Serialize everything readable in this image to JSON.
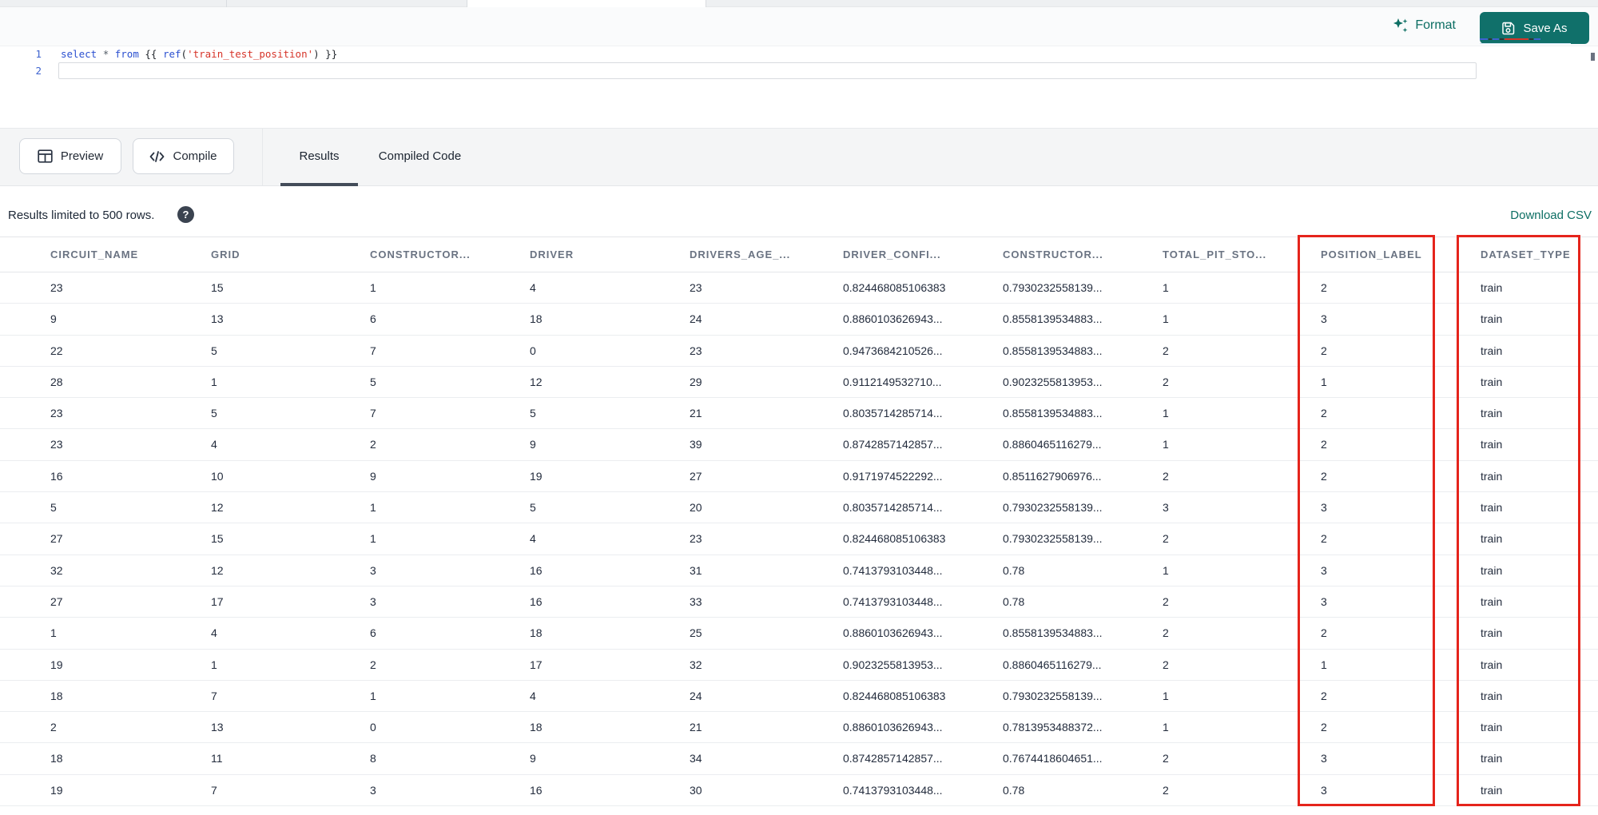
{
  "header": {
    "format_label": "Format",
    "save_as_label": "Save As"
  },
  "code_editor": {
    "lines": [
      {
        "number": "1",
        "tokens": [
          {
            "text": "select",
            "type": "kw"
          },
          {
            "text": " ",
            "type": "pl"
          },
          {
            "text": "*",
            "type": "op"
          },
          {
            "text": " ",
            "type": "pl"
          },
          {
            "text": "from",
            "type": "kw"
          },
          {
            "text": " {{ ",
            "type": "pl"
          },
          {
            "text": "ref",
            "type": "fn"
          },
          {
            "text": "(",
            "type": "pl"
          },
          {
            "text": "'train_test_position'",
            "type": "str"
          },
          {
            "text": ")",
            "type": "pl"
          },
          {
            "text": " }}",
            "type": "pl"
          }
        ]
      },
      {
        "number": "2",
        "tokens": []
      }
    ]
  },
  "toolbar": {
    "preview_label": "Preview",
    "compile_label": "Compile",
    "tabs": [
      {
        "label": "Results",
        "active": true
      },
      {
        "label": "Compiled Code",
        "active": false
      }
    ]
  },
  "results_bar": {
    "limit_text": "Results limited to 500 rows.",
    "help_glyph": "?",
    "download_label": "Download CSV"
  },
  "table": {
    "columns": [
      "CIRCUIT_NAME",
      "GRID",
      "CONSTRUCTOR...",
      "DRIVER",
      "DRIVERS_AGE_...",
      "DRIVER_CONFI...",
      "CONSTRUCTOR...",
      "TOTAL_PIT_STO...",
      "POSITION_LABEL",
      "DATASET_TYPE"
    ],
    "highlighted_columns": [
      "POSITION_LABEL",
      "DATASET_TYPE"
    ],
    "rows": [
      [
        "23",
        "15",
        "1",
        "4",
        "23",
        "0.824468085106383",
        "0.7930232558139...",
        "1",
        "2",
        "train"
      ],
      [
        "9",
        "13",
        "6",
        "18",
        "24",
        "0.8860103626943...",
        "0.8558139534883...",
        "1",
        "3",
        "train"
      ],
      [
        "22",
        "5",
        "7",
        "0",
        "23",
        "0.9473684210526...",
        "0.8558139534883...",
        "2",
        "2",
        "train"
      ],
      [
        "28",
        "1",
        "5",
        "12",
        "29",
        "0.9112149532710...",
        "0.9023255813953...",
        "2",
        "1",
        "train"
      ],
      [
        "23",
        "5",
        "7",
        "5",
        "21",
        "0.8035714285714...",
        "0.8558139534883...",
        "1",
        "2",
        "train"
      ],
      [
        "23",
        "4",
        "2",
        "9",
        "39",
        "0.8742857142857...",
        "0.8860465116279...",
        "1",
        "2",
        "train"
      ],
      [
        "16",
        "10",
        "9",
        "19",
        "27",
        "0.9171974522292...",
        "0.8511627906976...",
        "2",
        "2",
        "train"
      ],
      [
        "5",
        "12",
        "1",
        "5",
        "20",
        "0.8035714285714...",
        "0.7930232558139...",
        "3",
        "3",
        "train"
      ],
      [
        "27",
        "15",
        "1",
        "4",
        "23",
        "0.824468085106383",
        "0.7930232558139...",
        "2",
        "2",
        "train"
      ],
      [
        "32",
        "12",
        "3",
        "16",
        "31",
        "0.7413793103448...",
        "0.78",
        "1",
        "3",
        "train"
      ],
      [
        "27",
        "17",
        "3",
        "16",
        "33",
        "0.7413793103448...",
        "0.78",
        "2",
        "3",
        "train"
      ],
      [
        "1",
        "4",
        "6",
        "18",
        "25",
        "0.8860103626943...",
        "0.8558139534883...",
        "2",
        "2",
        "train"
      ],
      [
        "19",
        "1",
        "2",
        "17",
        "32",
        "0.9023255813953...",
        "0.8860465116279...",
        "2",
        "1",
        "train"
      ],
      [
        "18",
        "7",
        "1",
        "4",
        "24",
        "0.824468085106383",
        "0.7930232558139...",
        "1",
        "2",
        "train"
      ],
      [
        "2",
        "13",
        "0",
        "18",
        "21",
        "0.8860103626943...",
        "0.7813953488372...",
        "1",
        "2",
        "train"
      ],
      [
        "18",
        "11",
        "8",
        "9",
        "34",
        "0.8742857142857...",
        "0.7674418604651...",
        "2",
        "3",
        "train"
      ],
      [
        "19",
        "7",
        "3",
        "16",
        "30",
        "0.7413793103448...",
        "0.78",
        "2",
        "3",
        "train"
      ]
    ]
  },
  "colors": {
    "accent_teal": "#0C6E63",
    "save_button_bg": "#10706A",
    "highlight_red": "#E5241C",
    "keyword_blue": "#2B50D0",
    "string_red": "#D63429",
    "line_number_blue": "#3E63CF"
  }
}
